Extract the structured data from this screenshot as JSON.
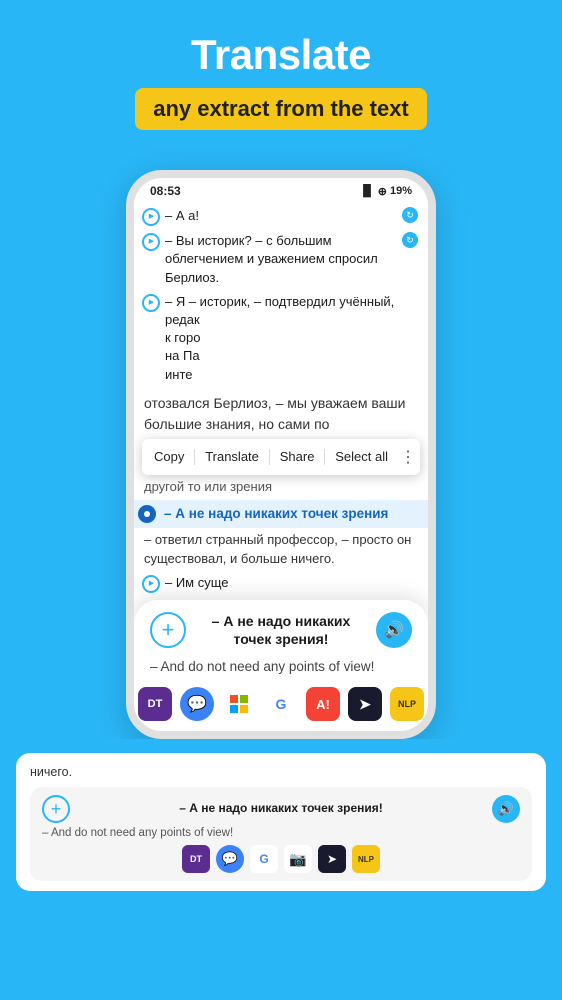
{
  "header": {
    "title": "Translate",
    "subtitle": "any extract from the text"
  },
  "phone": {
    "status": {
      "time": "08:53",
      "battery": "19%"
    },
    "textLines": [
      {
        "id": 1,
        "text": "– А а!",
        "hasSync": true
      },
      {
        "id": 2,
        "text": "– Вы историк? – с большим облегчением и уважением спросил Берлиоз.",
        "hasSync": true
      },
      {
        "id": 3,
        "text": "– Я – историк, – подтвердил учёный, редак к горо на Па инте",
        "hasSync": false
      }
    ],
    "overlayText": "отозвался Берлиоз, – мы уважаем ваши большие знания, но сами по",
    "contextMenu": {
      "copy": "Copy",
      "translate": "Translate",
      "share": "Share",
      "selectAll": "Select all"
    },
    "selectedText": "– А не надо никаких точек зрения",
    "selectedTextContinued": "– ответил странный профессор, – просто он существовал, и больше ничего.",
    "moreLines": [
      {
        "text": "– Им суще"
      }
    ]
  },
  "translationCard": {
    "originalText": "– А не надо никаких точек зрения!",
    "translatedText": "– And do not need any points of view!",
    "apps": [
      {
        "id": "dt",
        "label": "DT"
      },
      {
        "id": "bubble",
        "label": ""
      },
      {
        "id": "ms",
        "label": "MS"
      },
      {
        "id": "google",
        "label": "G"
      },
      {
        "id": "av",
        "label": "A!"
      },
      {
        "id": "arrow",
        "label": ">"
      },
      {
        "id": "nlp",
        "label": "NLP"
      }
    ]
  },
  "bottomCard": {
    "originalText": "– А не надо никаких точек зрения!",
    "translatedText": "– And do not need any points of view!"
  }
}
